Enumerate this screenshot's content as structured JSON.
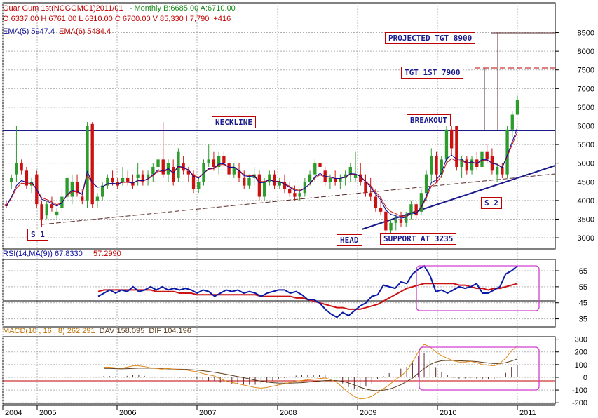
{
  "header": {
    "line1_instrument": "Guar Gum 1st(NCGGMC1)2011/01",
    "line1_quote": "- Monthly B:6685.00 A:6710.00",
    "line2": "O 6337.00 H 6761.00 L 6310.00 C 6700.00 V 85,330 I 7,790  +416",
    "ema5": "EMA(5) 5947.4",
    "ema6": "EMA(6) 5484.4"
  },
  "rsi_header": {
    "label": "RSI(14,MA(9))",
    "rsi": "67.8330",
    "ma": "57.2990"
  },
  "macd_header": {
    "label": "MACD(10 , 16 , 8)",
    "macd": "262.291",
    "dav": "DAV 158.095",
    "dif": "DIF 104.196"
  },
  "annotations": {
    "projected": "PROJECTED TGT 8900",
    "tgt1": "TGT 1ST 7900",
    "neckline": "NECKLINE",
    "breakout": "BREAKOUT",
    "s1": "S 1",
    "s2": "S 2",
    "head": "HEAD",
    "support": "SUPPORT AT 3235"
  },
  "colors": {
    "up": "#2e9b2e",
    "down": "#cc1111",
    "neckline": "#1a1a8c",
    "ema_short": "#0a0a9c",
    "ema_long": "#cc1111",
    "rsi": "#0a1aa8",
    "rsi_ma": "#cc1111",
    "macd": "#e08a1a",
    "signal": "#5a3a1a",
    "highlight": "#d040d0"
  },
  "chart_data": [
    {
      "type": "candlestick",
      "title": "Guar Gum 1st(NCGGMC1)2011/01 - Monthly",
      "x_labels": [
        "2004",
        "2005",
        "2006",
        "2007",
        "2008",
        "2009",
        "2010",
        "2011"
      ],
      "ylim": [
        2700,
        9300
      ],
      "y_ticks": [
        3000,
        3500,
        4000,
        4500,
        5000,
        5500,
        6000,
        6500,
        7000,
        7500,
        8000,
        8500
      ],
      "levels": {
        "neckline": 6060,
        "target_1": 7900,
        "projected_target": 8900,
        "support": 3235
      },
      "ohlc": [
        [
          3900,
          4000,
          3800,
          3850
        ],
        [
          4500,
          4700,
          4300,
          4600
        ],
        [
          4700,
          6000,
          4500,
          5000
        ],
        [
          5000,
          5100,
          4700,
          4800
        ],
        [
          4800,
          4900,
          4300,
          4400
        ],
        [
          4400,
          4600,
          4200,
          4500
        ],
        [
          4700,
          4800,
          3800,
          3900
        ],
        [
          3900,
          4000,
          3300,
          3500
        ],
        [
          3600,
          4000,
          3500,
          3900
        ],
        [
          3900,
          4100,
          3700,
          3800
        ],
        [
          3600,
          3800,
          3500,
          3700
        ],
        [
          3800,
          4300,
          3700,
          4100
        ],
        [
          4100,
          4700,
          4000,
          4600
        ],
        [
          4100,
          4700,
          3900,
          4500
        ],
        [
          4500,
          4700,
          4100,
          4200
        ],
        [
          4100,
          4300,
          3900,
          4000
        ],
        [
          4000,
          6100,
          3800,
          6000
        ],
        [
          6050,
          6100,
          3800,
          3900
        ],
        [
          4000,
          4200,
          3800,
          4100
        ],
        [
          4100,
          4500,
          4000,
          4400
        ],
        [
          4400,
          4700,
          4300,
          4600
        ],
        [
          4600,
          4800,
          4400,
          4500
        ],
        [
          4500,
          4600,
          4300,
          4400
        ],
        [
          4500,
          4900,
          4400,
          4600
        ],
        [
          4600,
          4800,
          4400,
          4500
        ],
        [
          4500,
          4700,
          4300,
          4400
        ],
        [
          4600,
          5000,
          4400,
          4700
        ],
        [
          4700,
          4800,
          4400,
          4500
        ],
        [
          4600,
          4800,
          4400,
          4700
        ],
        [
          4700,
          5000,
          4500,
          4900
        ],
        [
          4900,
          5200,
          4700,
          5100
        ],
        [
          5100,
          6100,
          4600,
          4700
        ],
        [
          4700,
          5100,
          4500,
          5000
        ],
        [
          4900,
          5100,
          4400,
          4500
        ],
        [
          4600,
          5400,
          4500,
          5300
        ],
        [
          5000,
          5200,
          4700,
          4800
        ],
        [
          4800,
          4900,
          4500,
          4700
        ],
        [
          4700,
          4800,
          4200,
          4300
        ],
        [
          4300,
          4600,
          4200,
          4500
        ],
        [
          4500,
          5100,
          4400,
          5000
        ],
        [
          5000,
          5500,
          4900,
          5100
        ],
        [
          5100,
          5300,
          4800,
          4900
        ],
        [
          4900,
          5300,
          4700,
          5200
        ],
        [
          5200,
          5300,
          4900,
          5000
        ],
        [
          5000,
          5100,
          4600,
          4700
        ],
        [
          4700,
          5000,
          4600,
          4900
        ],
        [
          4800,
          5000,
          4500,
          4600
        ],
        [
          4600,
          4800,
          4300,
          4400
        ],
        [
          4400,
          4700,
          4300,
          4600
        ],
        [
          4600,
          4900,
          4400,
          4700
        ],
        [
          4700,
          4800,
          4000,
          4100
        ],
        [
          4100,
          4600,
          4000,
          4500
        ],
        [
          4500,
          4800,
          4400,
          4700
        ],
        [
          4700,
          4800,
          4300,
          4400
        ],
        [
          4400,
          4600,
          4300,
          4500
        ],
        [
          4500,
          4700,
          4200,
          4300
        ],
        [
          4300,
          4500,
          4100,
          4200
        ],
        [
          4200,
          4400,
          4000,
          4100
        ],
        [
          4100,
          4300,
          4000,
          4200
        ],
        [
          4200,
          4600,
          4100,
          4500
        ],
        [
          4500,
          4800,
          4400,
          4700
        ],
        [
          4700,
          5100,
          4500,
          5000
        ],
        [
          5000,
          5200,
          4800,
          4900
        ],
        [
          4800,
          4900,
          4400,
          4500
        ],
        [
          4500,
          4700,
          4300,
          4600
        ],
        [
          4600,
          4800,
          4400,
          4500
        ],
        [
          4500,
          4700,
          4300,
          4600
        ],
        [
          4600,
          4800,
          4400,
          4700
        ],
        [
          4700,
          5000,
          4500,
          4900
        ],
        [
          4600,
          5300,
          4500,
          4700
        ],
        [
          4700,
          5000,
          4400,
          4500
        ],
        [
          4500,
          4700,
          4100,
          4200
        ],
        [
          4200,
          4600,
          4000,
          4100
        ],
        [
          4100,
          4300,
          3700,
          3800
        ],
        [
          3800,
          4000,
          3600,
          3700
        ],
        [
          3700,
          3900,
          3100,
          3200
        ],
        [
          3200,
          3500,
          3100,
          3400
        ],
        [
          3400,
          3600,
          3200,
          3500
        ],
        [
          3500,
          3700,
          3300,
          3400
        ],
        [
          3400,
          3700,
          3300,
          3600
        ],
        [
          3600,
          4000,
          3500,
          3900
        ],
        [
          3900,
          4000,
          3500,
          3600
        ],
        [
          3700,
          4300,
          3600,
          4200
        ],
        [
          4200,
          4800,
          4000,
          4700
        ],
        [
          4700,
          5400,
          4500,
          5200
        ],
        [
          5200,
          5300,
          4500,
          4700
        ],
        [
          4700,
          5200,
          4600,
          5100
        ],
        [
          5100,
          6000,
          5000,
          5900
        ],
        [
          5900,
          6000,
          5200,
          5400
        ],
        [
          6000,
          6000,
          4800,
          4900
        ],
        [
          4900,
          5200,
          4600,
          5100
        ],
        [
          5100,
          5200,
          4700,
          4800
        ],
        [
          4800,
          5200,
          4700,
          5100
        ],
        [
          5100,
          5300,
          4800,
          4900
        ],
        [
          4900,
          5400,
          4800,
          5300
        ],
        [
          5300,
          5500,
          5000,
          5100
        ],
        [
          5200,
          5400,
          4700,
          4800
        ],
        [
          4700,
          5000,
          4500,
          4900
        ],
        [
          4900,
          5000,
          4600,
          4700
        ],
        [
          4700,
          6000,
          4600,
          5900
        ],
        [
          5900,
          6400,
          5700,
          6300
        ],
        [
          6300,
          6800,
          6300,
          6700
        ]
      ]
    },
    {
      "type": "line",
      "title": "RSI(14,MA(9))",
      "y_ticks": [
        35,
        45,
        55,
        65
      ],
      "ylim": [
        30,
        72
      ],
      "series": [
        {
          "name": "RSI",
          "values": [
            49,
            51,
            53,
            51,
            53,
            52,
            55,
            52,
            53,
            55,
            53,
            55,
            53,
            54,
            53,
            54,
            53,
            51,
            53,
            52,
            49,
            51,
            53,
            52,
            53,
            51,
            52,
            51,
            49,
            51,
            52,
            53,
            53,
            51,
            52,
            50,
            47,
            47,
            45,
            41,
            38,
            36,
            39,
            37,
            40,
            43,
            45,
            49,
            50,
            56,
            55,
            54,
            58,
            57,
            63,
            66,
            68,
            62,
            52,
            53,
            51,
            53,
            55,
            54,
            55,
            57,
            51,
            51,
            53,
            55,
            63,
            65,
            68
          ]
        },
        {
          "name": "MA",
          "values": [
            52,
            53,
            53,
            53,
            53,
            53,
            53,
            53,
            53,
            53,
            52,
            52,
            52,
            52,
            51,
            51,
            51,
            50,
            50,
            50,
            50,
            50,
            50,
            50,
            50,
            50,
            50,
            50,
            49,
            49,
            49,
            49,
            49,
            49,
            48,
            48,
            47,
            46,
            45,
            44,
            43,
            42,
            42,
            41,
            41,
            41,
            42,
            43,
            44,
            46,
            48,
            50,
            52,
            54,
            55,
            56,
            57,
            57,
            57,
            57,
            57,
            57,
            56,
            56,
            55,
            54,
            54,
            53,
            54,
            54,
            55,
            56,
            57
          ]
        }
      ]
    },
    {
      "type": "line",
      "title": "MACD(10 , 16 , 8)",
      "y_ticks": [
        -200,
        -100,
        0,
        100,
        200,
        300
      ],
      "ylim": [
        -210,
        320
      ],
      "series": [
        {
          "name": "MACD",
          "values": [
            80,
            80,
            75,
            70,
            80,
            90,
            90,
            85,
            75,
            70,
            65,
            70,
            65,
            60,
            60,
            50,
            45,
            30,
            20,
            10,
            -10,
            -30,
            -40,
            -50,
            -60,
            -70,
            -80,
            -85,
            -80,
            -70,
            -60,
            -50,
            -40,
            -30,
            -25,
            -20,
            -15,
            -10,
            -5,
            -20,
            -40,
            -80,
            -120,
            -150,
            -170,
            -165,
            -150,
            -120,
            -90,
            -60,
            -20,
            10,
            50,
            120,
            200,
            260,
            240,
            200,
            170,
            150,
            130,
            120,
            120,
            125,
            115,
            100,
            95,
            90,
            110,
            150,
            210,
            245
          ]
        },
        {
          "name": "Signal",
          "values": [
            70,
            70,
            68,
            67,
            68,
            70,
            72,
            73,
            72,
            70,
            68,
            67,
            65,
            64,
            63,
            60,
            57,
            52,
            46,
            40,
            32,
            24,
            15,
            6,
            -3,
            -12,
            -22,
            -30,
            -37,
            -42,
            -45,
            -46,
            -46,
            -44,
            -42,
            -38,
            -34,
            -30,
            -26,
            -25,
            -26,
            -32,
            -44,
            -60,
            -78,
            -92,
            -102,
            -105,
            -101,
            -93,
            -78,
            -58,
            -33,
            -6,
            32,
            70,
            100,
            120,
            130,
            133,
            132,
            130,
            128,
            127,
            124,
            118,
            112,
            108,
            108,
            115,
            128,
            145
          ]
        }
      ]
    }
  ]
}
